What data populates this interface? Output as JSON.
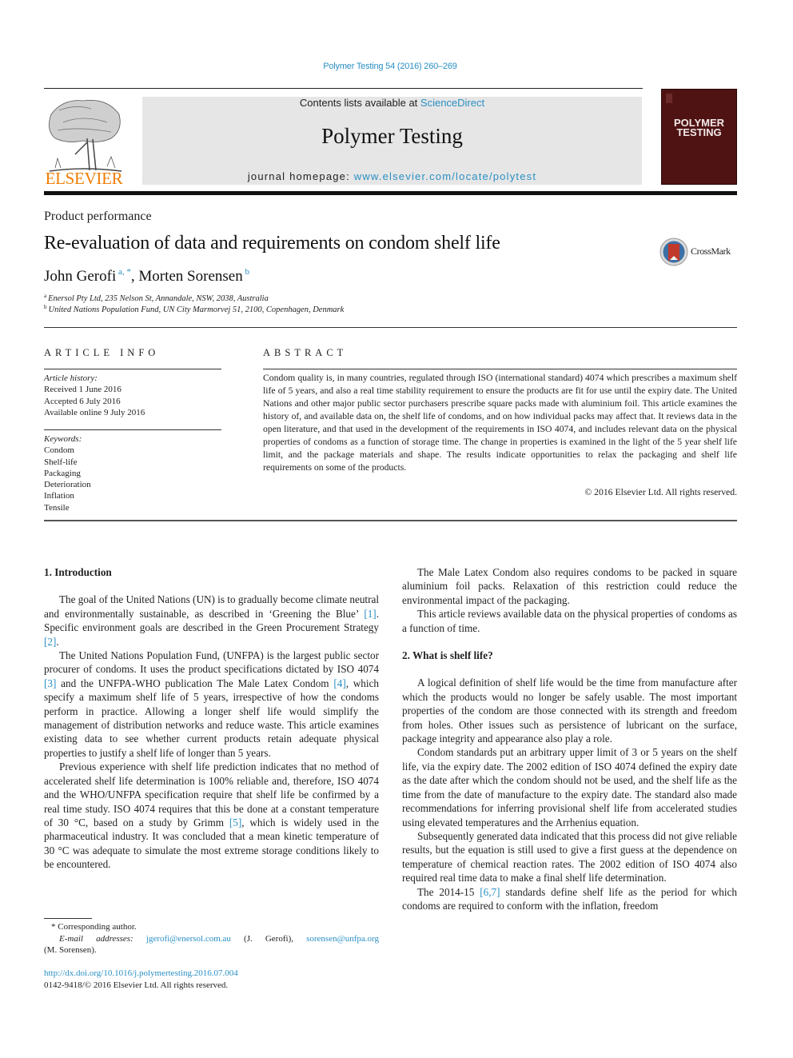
{
  "header": {
    "citation": "Polymer Testing 54 (2016) 260–269",
    "contents_prefix": "Contents lists available at ",
    "contents_link": "ScienceDirect",
    "journal_name": "Polymer Testing",
    "homepage_prefix": "journal homepage: ",
    "homepage_link": "www.elsevier.com/locate/polytest",
    "publisher_logo_text": "ELSEVIER",
    "cover_title_line1": "POLYMER",
    "cover_title_line2": "TESTING",
    "crossmark_label": "CrossMark"
  },
  "colors": {
    "link": "#2a8fc4",
    "elsevier_orange": "#f07c00",
    "cover_bg": "#4f1313",
    "masthead_bg": "#e6e6e6"
  },
  "article": {
    "section_type": "Product performance",
    "title": "Re-evaluation of data and requirements on condom shelf life",
    "authors": [
      {
        "name": "John Gerofi",
        "marks": "a, *"
      },
      {
        "name": "Morten Sorensen",
        "marks": "b"
      }
    ],
    "author_separator": ", ",
    "affiliations": [
      {
        "mark": "a",
        "text": "Enersol Pty Ltd, 235 Nelson St, Annandale, NSW, 2038, Australia"
      },
      {
        "mark": "b",
        "text": "United Nations Population Fund, UN City Marmorvej 51, 2100, Copenhagen, Denmark"
      }
    ]
  },
  "article_info": {
    "heading": "ARTICLE INFO",
    "history_label": "Article history:",
    "history": [
      "Received 1 June 2016",
      "Accepted 6 July 2016",
      "Available online 9 July 2016"
    ],
    "keywords_label": "Keywords:",
    "keywords": [
      "Condom",
      "Shelf-life",
      "Packaging",
      "Deterioration",
      "Inflation",
      "Tensile"
    ]
  },
  "abstract": {
    "heading": "ABSTRACT",
    "text": "Condom quality is, in many countries, regulated through ISO (international standard) 4074 which prescribes a maximum shelf life of 5 years, and also a real time stability requirement to ensure the products are fit for use until the expiry date. The United Nations and other major public sector purchasers prescribe square packs made with aluminium foil. This article examines the history of, and available data on, the shelf life of condoms, and on how individual packs may affect that. It reviews data in the open literature, and that used in the development of the requirements in ISO 4074, and includes relevant data on the physical properties of condoms as a function of storage time. The change in properties is examined in the light of the 5 year shelf life limit, and the package materials and shape. The results indicate opportunities to relax the packaging and shelf life requirements on some of the products.",
    "copyright": "© 2016 Elsevier Ltd. All rights reserved."
  },
  "body": {
    "sec1_heading": "1.  Introduction",
    "sec1_p1_a": "The goal of the United Nations (UN) is to gradually become climate neutral and environmentally sustainable, as described in ‘Greening the Blue’ ",
    "sec1_p1_ref1": "[1]",
    "sec1_p1_b": ". Specific environment goals are described in the Green Procurement Strategy ",
    "sec1_p1_ref2": "[2]",
    "sec1_p1_c": ".",
    "sec1_p2_a": "The United Nations Population Fund, (UNFPA) is the largest public sector procurer of condoms. It uses the product specifications dictated by ISO 4074 ",
    "sec1_p2_ref3": "[3]",
    "sec1_p2_b": " and the UNFPA-WHO publication The Male Latex Condom ",
    "sec1_p2_ref4": "[4]",
    "sec1_p2_c": ", which specify a maximum shelf life of 5 years, irrespective of how the condoms perform in practice. Allowing a longer shelf life would simplify the management of distribution networks and reduce waste. This article examines existing data to see whether current products retain adequate physical properties to justify a shelf life of longer than 5 years.",
    "sec1_p3_a": "Previous experience with shelf life prediction indicates that no method of accelerated shelf life determination is 100% reliable and, therefore, ISO 4074 and the WHO/UNFPA specification require that shelf life be confirmed by a real time study. ISO 4074 requires that this be done at a constant temperature of 30 °C, based on a study by Grimm ",
    "sec1_p3_ref5": "[5]",
    "sec1_p3_b": ", which is widely used in the pharmaceutical industry. It was concluded that a mean kinetic temperature of 30 °C was adequate to simulate the most extreme storage conditions likely to be encountered.",
    "sec1_p4": "The Male Latex Condom also requires condoms to be packed in square aluminium foil packs. Relaxation of this restriction could reduce the environmental impact of the packaging.",
    "sec1_p5": "This article reviews available data on the physical properties of condoms as a function of time.",
    "sec2_heading": "2.  What is shelf life?",
    "sec2_p1": "A logical definition of shelf life would be the time from manufacture after which the products would no longer be safely usable. The most important properties of the condom are those connected with its strength and freedom from holes. Other issues such as persistence of lubricant on the surface, package integrity and appearance also play a role.",
    "sec2_p2": "Condom standards put an arbitrary upper limit of 3 or 5 years on the shelf life, via the expiry date. The 2002 edition of ISO 4074 defined the expiry date as the date after which the condom should not be used, and the shelf life as the time from the date of manufacture to the expiry date. The standard also made recommendations for inferring provisional shelf life from accelerated studies using elevated temperatures and the Arrhenius equation.",
    "sec2_p3": "Subsequently generated data indicated that this process did not give reliable results, but the equation is still used to give a first guess at the dependence on temperature of chemical reaction rates. The 2002 edition of ISO 4074 also required real time data to make a final shelf life determination.",
    "sec2_p4_a": "The 2014-15 ",
    "sec2_p4_ref": "[6,7]",
    "sec2_p4_b": " standards define shelf life as the period for which condoms are required to conform with the inflation, freedom"
  },
  "footnotes": {
    "corresponding": "* Corresponding author.",
    "email_label": "E-mail addresses:",
    "email1": "jgerofi@enersol.com.au",
    "email1_owner": " (J. Gerofi), ",
    "email2": "sorensen@unfpa.org",
    "email2_owner": "(M. Sorensen).",
    "doi": "http://dx.doi.org/10.1016/j.polymertesting.2016.07.004",
    "issn": "0142-9418/© 2016 Elsevier Ltd. All rights reserved."
  }
}
